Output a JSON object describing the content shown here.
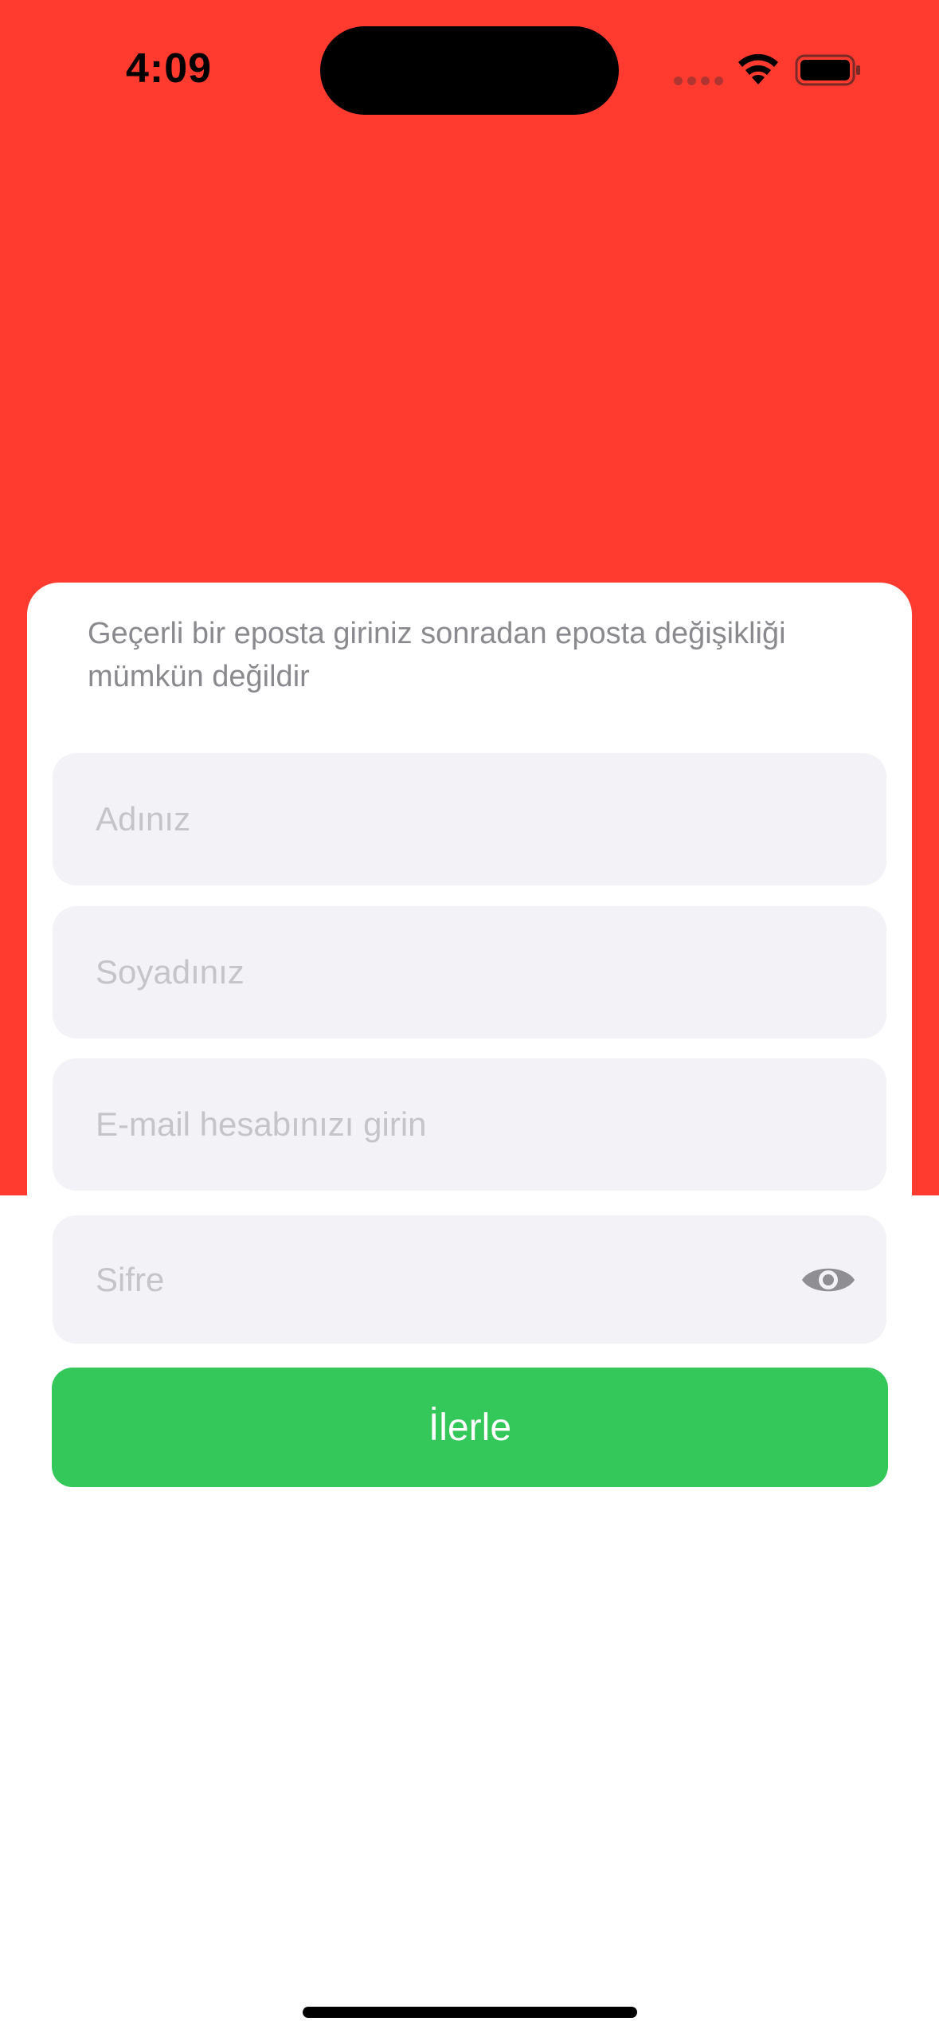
{
  "status_bar": {
    "time": "4:09"
  },
  "form": {
    "info_text": "Geçerli bir eposta giriniz sonradan eposta değişikliği mümkün değildir",
    "first_name_placeholder": "Adınız",
    "last_name_placeholder": "Soyadınız",
    "email_placeholder": "E-mail hesabınızı girin",
    "password_placeholder": "Sifre",
    "submit_label": "İlerle"
  },
  "icons": {
    "wifi": "wifi-icon",
    "battery": "battery-icon",
    "password_toggle": "eye-icon"
  },
  "colors": {
    "header_background": "#ff3b30",
    "field_background": "#f2f2f7",
    "button_background": "#34c759",
    "info_text": "#8a8a8e",
    "placeholder": "#c4c4c9"
  }
}
